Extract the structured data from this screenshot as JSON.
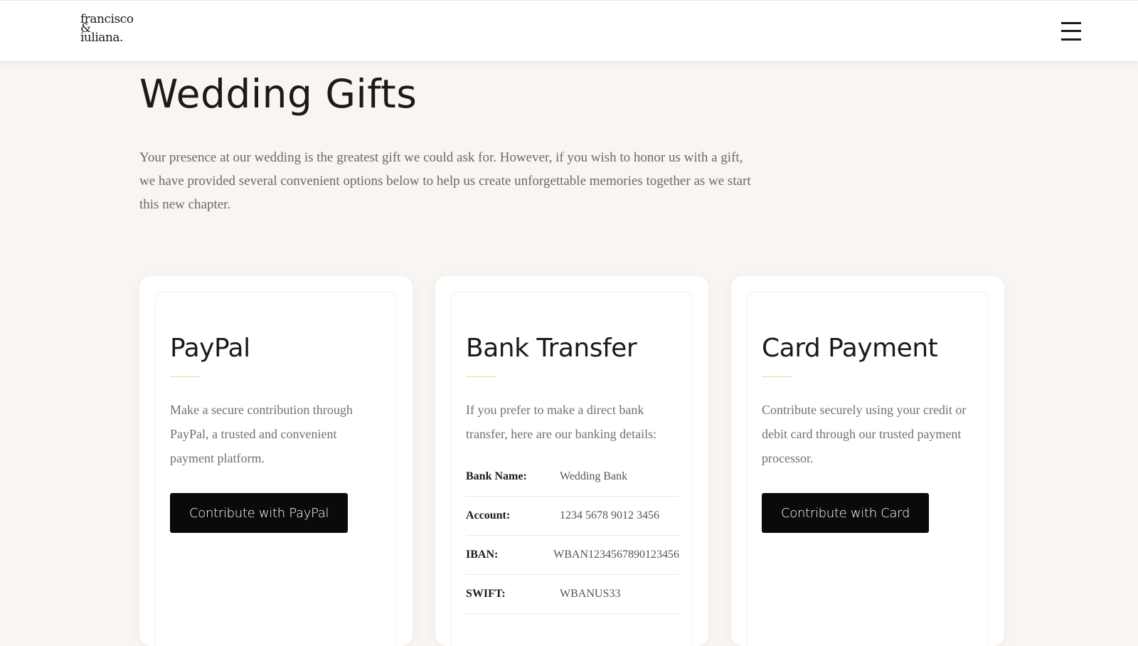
{
  "header": {
    "logo_line1": "francisco",
    "logo_line2": "&",
    "logo_line3": "iuliana."
  },
  "main": {
    "title": "Wedding Gifts",
    "intro": "Your presence at our wedding is the greatest gift we could ask for. However, if you wish to honor us with a gift, we have provided several convenient options below to help us create unforgettable memories together as we start this new chapter."
  },
  "cards": {
    "paypal": {
      "title": "PayPal",
      "text": "Make a secure contribution through PayPal, a trusted and convenient payment platform.",
      "button": "Contribute with PayPal"
    },
    "bank": {
      "title": "Bank Transfer",
      "text": "If you prefer to make a direct bank transfer, here are our banking details:",
      "rows": [
        {
          "label": "Bank Name:",
          "value": "Wedding Bank"
        },
        {
          "label": "Account:",
          "value": "1234 5678 9012 3456"
        },
        {
          "label": "IBAN:",
          "value": "WBAN1234567890123456"
        },
        {
          "label": "SWIFT:",
          "value": "WBANUS33"
        }
      ]
    },
    "card": {
      "title": "Card Payment",
      "text": "Contribute securely using your credit or debit card through our trusted payment processor.",
      "button": "Contribute with Card"
    }
  },
  "icons": {
    "menu": "hamburger-menu-icon"
  },
  "colors": {
    "background": "#f8f5f2",
    "button": "#0a0a0a",
    "accent_divider": "#e3d9b4"
  }
}
